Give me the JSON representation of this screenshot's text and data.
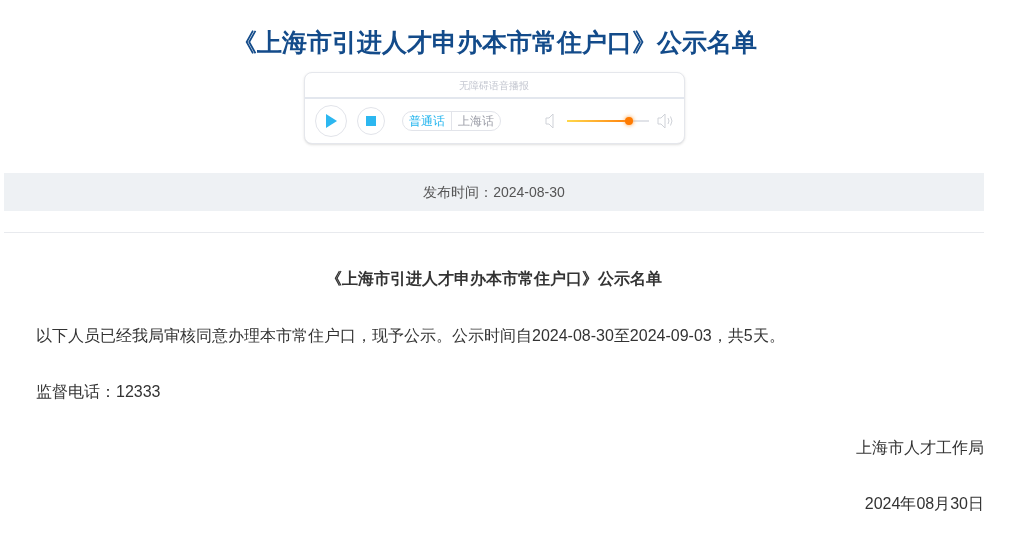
{
  "title": "《上海市引进人才申办本市常住户口》公示名单",
  "player": {
    "label": "无障碍语音播报",
    "languages": [
      {
        "label": "普通话",
        "selected": true
      },
      {
        "label": "上海话",
        "selected": false
      }
    ],
    "volume": {
      "level": 0.76
    }
  },
  "publish_date": "发布时间：2024-08-30",
  "article": {
    "heading": "《上海市引进人才申办本市常住户口》公示名单",
    "paragraphs": [
      "以下人员已经我局审核同意办理本市常住户口，现予公示。公示时间自2024-08-30至2024-09-03，共5天。",
      "监督电话：12333"
    ],
    "signature": "上海市人才工作局",
    "date": "2024年08月30日"
  }
}
